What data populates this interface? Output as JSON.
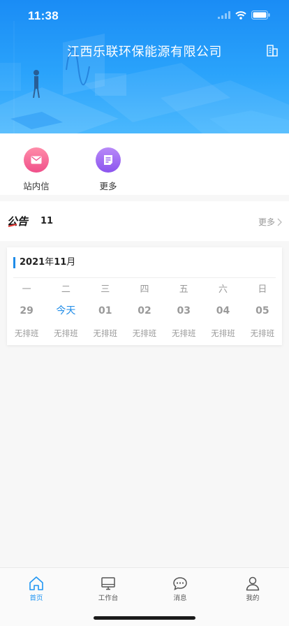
{
  "status_bar": {
    "time": "11:38"
  },
  "header": {
    "title": "江西乐联环保能源有限公司"
  },
  "shortcuts": [
    {
      "label": "站内信",
      "icon": "mail-icon",
      "color": "#f0508a"
    },
    {
      "label": "更多",
      "icon": "doc-icon",
      "color": "#8b54ee"
    }
  ],
  "notice": {
    "logo_text": "公告",
    "count": "11",
    "more_label": "更多"
  },
  "calendar": {
    "year": "2021",
    "year_suffix": "年",
    "month": "11",
    "month_suffix": "月",
    "weekdays": [
      "一",
      "二",
      "三",
      "四",
      "五",
      "六",
      "日"
    ],
    "days": [
      "29",
      "今天",
      "01",
      "02",
      "03",
      "04",
      "05"
    ],
    "shifts": [
      "无排班",
      "无排班",
      "无排班",
      "无排班",
      "无排班",
      "无排班",
      "无排班"
    ],
    "accent_color": "#1f8ce8"
  },
  "tabbar": {
    "tabs": [
      {
        "label": "首页",
        "icon": "home-icon",
        "active": true
      },
      {
        "label": "工作台",
        "icon": "monitor-icon",
        "active": false
      },
      {
        "label": "消息",
        "icon": "chat-icon",
        "active": false
      },
      {
        "label": "我的",
        "icon": "user-icon",
        "active": false
      }
    ],
    "active_color": "#2196f3"
  }
}
